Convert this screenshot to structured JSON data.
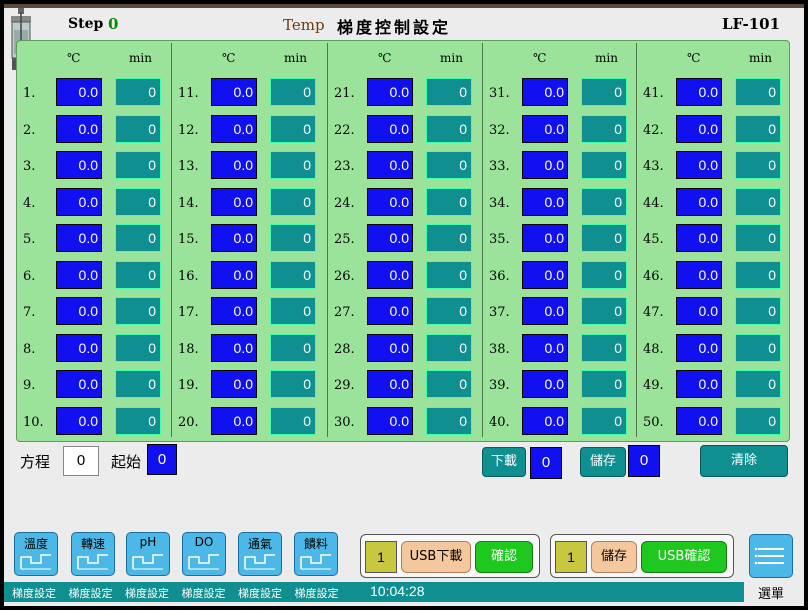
{
  "header": {
    "step_label": "Step",
    "step_value": "0",
    "temp_label": "Temp",
    "title": "梯度控制設定",
    "model": "LF-101"
  },
  "grid": {
    "temp_unit": "℃",
    "time_unit": "min",
    "columns": [
      {
        "rows": [
          {
            "label": "1.",
            "temp": "0.0",
            "min": "0"
          },
          {
            "label": "2.",
            "temp": "0.0",
            "min": "0"
          },
          {
            "label": "3.",
            "temp": "0.0",
            "min": "0"
          },
          {
            "label": "4.",
            "temp": "0.0",
            "min": "0"
          },
          {
            "label": "5.",
            "temp": "0.0",
            "min": "0"
          },
          {
            "label": "6.",
            "temp": "0.0",
            "min": "0"
          },
          {
            "label": "7.",
            "temp": "0.0",
            "min": "0"
          },
          {
            "label": "8.",
            "temp": "0.0",
            "min": "0"
          },
          {
            "label": "9.",
            "temp": "0.0",
            "min": "0"
          },
          {
            "label": "10.",
            "temp": "0.0",
            "min": "0"
          }
        ]
      },
      {
        "rows": [
          {
            "label": "11.",
            "temp": "0.0",
            "min": "0"
          },
          {
            "label": "12.",
            "temp": "0.0",
            "min": "0"
          },
          {
            "label": "13.",
            "temp": "0.0",
            "min": "0"
          },
          {
            "label": "14.",
            "temp": "0.0",
            "min": "0"
          },
          {
            "label": "15.",
            "temp": "0.0",
            "min": "0"
          },
          {
            "label": "16.",
            "temp": "0.0",
            "min": "0"
          },
          {
            "label": "17.",
            "temp": "0.0",
            "min": "0"
          },
          {
            "label": "18.",
            "temp": "0.0",
            "min": "0"
          },
          {
            "label": "19.",
            "temp": "0.0",
            "min": "0"
          },
          {
            "label": "20.",
            "temp": "0.0",
            "min": "0"
          }
        ]
      },
      {
        "rows": [
          {
            "label": "21.",
            "temp": "0.0",
            "min": "0"
          },
          {
            "label": "22.",
            "temp": "0.0",
            "min": "0"
          },
          {
            "label": "23.",
            "temp": "0.0",
            "min": "0"
          },
          {
            "label": "24.",
            "temp": "0.0",
            "min": "0"
          },
          {
            "label": "25.",
            "temp": "0.0",
            "min": "0"
          },
          {
            "label": "26.",
            "temp": "0.0",
            "min": "0"
          },
          {
            "label": "27.",
            "temp": "0.0",
            "min": "0"
          },
          {
            "label": "28.",
            "temp": "0.0",
            "min": "0"
          },
          {
            "label": "29.",
            "temp": "0.0",
            "min": "0"
          },
          {
            "label": "30.",
            "temp": "0.0",
            "min": "0"
          }
        ]
      },
      {
        "rows": [
          {
            "label": "31.",
            "temp": "0.0",
            "min": "0"
          },
          {
            "label": "32.",
            "temp": "0.0",
            "min": "0"
          },
          {
            "label": "33.",
            "temp": "0.0",
            "min": "0"
          },
          {
            "label": "34.",
            "temp": "0.0",
            "min": "0"
          },
          {
            "label": "35.",
            "temp": "0.0",
            "min": "0"
          },
          {
            "label": "36.",
            "temp": "0.0",
            "min": "0"
          },
          {
            "label": "37.",
            "temp": "0.0",
            "min": "0"
          },
          {
            "label": "38.",
            "temp": "0.0",
            "min": "0"
          },
          {
            "label": "39.",
            "temp": "0.0",
            "min": "0"
          },
          {
            "label": "40.",
            "temp": "0.0",
            "min": "0"
          }
        ]
      },
      {
        "rows": [
          {
            "label": "41.",
            "temp": "0.0",
            "min": "0"
          },
          {
            "label": "42.",
            "temp": "0.0",
            "min": "0"
          },
          {
            "label": "43.",
            "temp": "0.0",
            "min": "0"
          },
          {
            "label": "44.",
            "temp": "0.0",
            "min": "0"
          },
          {
            "label": "45.",
            "temp": "0.0",
            "min": "0"
          },
          {
            "label": "46.",
            "temp": "0.0",
            "min": "0"
          },
          {
            "label": "47.",
            "temp": "0.0",
            "min": "0"
          },
          {
            "label": "48.",
            "temp": "0.0",
            "min": "0"
          },
          {
            "label": "49.",
            "temp": "0.0",
            "min": "0"
          },
          {
            "label": "50.",
            "temp": "0.0",
            "min": "0"
          }
        ]
      }
    ]
  },
  "controls": {
    "equation_label": "方程",
    "equation_value": "0",
    "start_label": "起始",
    "start_value": "0",
    "download_label": "下載",
    "download_value": "0",
    "save_label": "儲存",
    "save_value": "0",
    "clear_label": "清除"
  },
  "nav": {
    "buttons": [
      {
        "label": "溫度",
        "icon": "gradient-step-icon"
      },
      {
        "label": "轉速",
        "icon": "gradient-step-icon"
      },
      {
        "label": "pH",
        "icon": "gradient-step-icon"
      },
      {
        "label": "DO",
        "icon": "gradient-step-icon"
      },
      {
        "label": "通氣",
        "icon": "gradient-step-icon"
      },
      {
        "label": "饋料",
        "icon": "gradient-step-icon"
      }
    ]
  },
  "usb_download": {
    "number": "1",
    "action_label": "USB下載",
    "confirm_label": "確認"
  },
  "usb_save": {
    "number": "1",
    "action_label": "儲存",
    "confirm_label": "USB確認"
  },
  "menu": {
    "label": "選單",
    "icon": "menu-lines-icon"
  },
  "status": {
    "items": [
      "梯度設定",
      "梯度設定",
      "梯度設定",
      "梯度設定",
      "梯度設定",
      "梯度設定"
    ],
    "time": "10:04:28"
  },
  "colors": {
    "panel_green": "#9be39b",
    "temp_box_blue": "#1010f0",
    "time_box_teal": "#0f8f8f",
    "nav_blue": "#4bb8e8"
  }
}
